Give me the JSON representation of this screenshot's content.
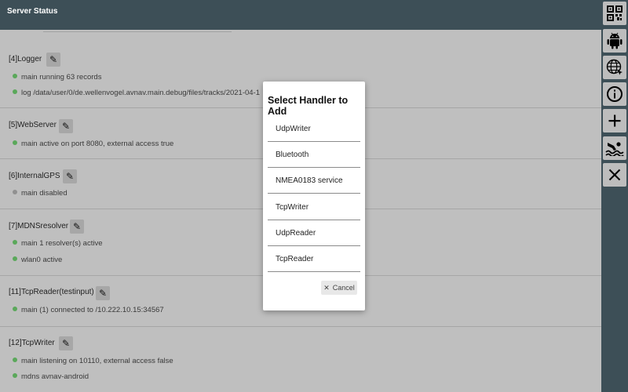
{
  "header": {
    "title": "Server Status"
  },
  "toolbar": {
    "buttons": [
      {
        "name": "qrcode-button",
        "icon": "qr-code-icon",
        "glyph": "▦"
      },
      {
        "name": "android-button",
        "icon": "android-icon",
        "glyph": "🤖"
      },
      {
        "name": "network-button",
        "icon": "globe-icon",
        "glyph": "🌐"
      },
      {
        "name": "info-button",
        "icon": "info-icon",
        "glyph": "ⓘ"
      },
      {
        "name": "add-button",
        "icon": "plus-icon",
        "glyph": "+"
      },
      {
        "name": "mob-button",
        "icon": "swimmer-icon",
        "glyph": "🏊"
      },
      {
        "name": "close-button",
        "icon": "close-icon",
        "glyph": "✕"
      }
    ]
  },
  "sections": [
    {
      "title": "[4]Logger",
      "lines": [
        {
          "status": "green",
          "text": "main running 63 records"
        },
        {
          "status": "green",
          "text": "log /data/user/0/de.wellenvogel.avnav.main.debug/files/tracks/2021-04-1"
        }
      ]
    },
    {
      "title": "[5]WebServer",
      "lines": [
        {
          "status": "green",
          "text": "main active on port 8080, external access true"
        }
      ]
    },
    {
      "title": "[6]InternalGPS",
      "lines": [
        {
          "status": "grey",
          "text": "main disabled"
        }
      ]
    },
    {
      "title": "[7]MDNSresolver",
      "lines": [
        {
          "status": "green",
          "text": "main 1 resolver(s) active"
        },
        {
          "status": "green",
          "text": "wlan0 active"
        }
      ]
    },
    {
      "title": "[11]TcpReader(testinput)",
      "lines": [
        {
          "status": "green",
          "text": "main (1) connected to /10.222.10.15:34567"
        }
      ]
    },
    {
      "title": "[12]TcpWriter",
      "lines": [
        {
          "status": "green",
          "text": "main listening on 10110, external access false"
        },
        {
          "status": "green",
          "text": "mdns avnav-android"
        }
      ]
    }
  ],
  "dialog": {
    "title": "Select Handler to Add",
    "items": [
      "UdpWriter",
      "Bluetooth",
      "NMEA0183 service",
      "TcpWriter",
      "UdpReader",
      "TcpReader"
    ],
    "cancel_label": "Cancel"
  }
}
